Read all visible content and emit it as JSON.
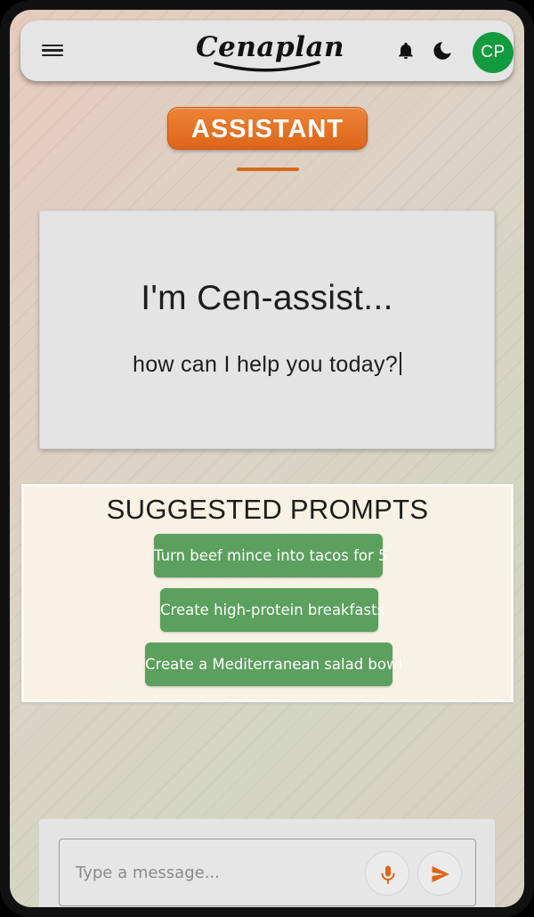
{
  "app": {
    "logo_text": "Cenaplan",
    "avatar_initials": "CP"
  },
  "icons": {
    "menu": "hamburger-menu-icon",
    "bell": "bell-icon",
    "theme": "moon-icon",
    "mic": "microphone-icon",
    "send": "send-icon"
  },
  "colors": {
    "accent_orange": "#dd6519",
    "prompt_green": "#5ba05e",
    "avatar_green": "#139a3f"
  },
  "header": {
    "section_badge": "ASSISTANT"
  },
  "intro": {
    "title": "I'm Cen-assist...",
    "subtitle": "how can I help you today?"
  },
  "prompts": {
    "title": "SUGGESTED PROMPTS",
    "items": [
      {
        "label": "Turn beef mince into tacos for 5"
      },
      {
        "label": "Create high-protein breakfasts"
      },
      {
        "label": "Create a Mediterranean salad bowl"
      }
    ]
  },
  "composer": {
    "placeholder": "Type a message..."
  }
}
